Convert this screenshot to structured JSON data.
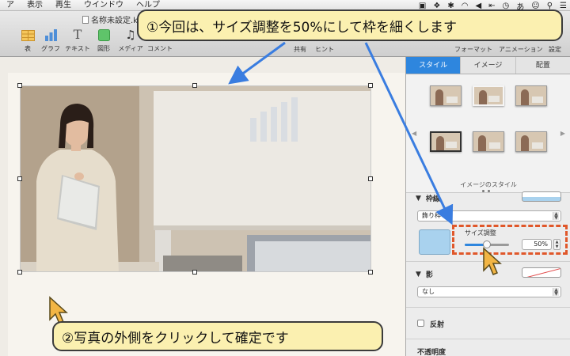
{
  "menubar": {
    "items": [
      "ア",
      "表示",
      "再生",
      "ウインドウ",
      "ヘルプ"
    ],
    "status_icons": [
      "screen-icon",
      "dropbox-icon",
      "bluetooth-icon",
      "wifi-icon",
      "volume-icon",
      "back-icon",
      "clock-icon",
      "input-method-icon",
      "user-icon",
      "search-icon",
      "list-icon"
    ],
    "input_method_label": "あ"
  },
  "toolbar": {
    "doc_title": "名称未設定.k",
    "items": [
      {
        "label": "表",
        "icon": "table-icon"
      },
      {
        "label": "グラフ",
        "icon": "chart-icon"
      },
      {
        "label": "テキスト",
        "icon": "text-icon"
      },
      {
        "label": "図形",
        "icon": "shape-icon"
      },
      {
        "label": "メディア",
        "icon": "media-icon"
      },
      {
        "label": "コメント",
        "icon": "comment-icon"
      }
    ],
    "right_items": [
      "共有",
      "ヒント",
      "フォーマット",
      "アニメーション",
      "設定"
    ]
  },
  "inspector": {
    "tabs": [
      "スタイル",
      "イメージ",
      "配置"
    ],
    "active_tab": "スタイル",
    "image_styles_label": "イメージのスタイル",
    "border": {
      "title": "枠線",
      "type": "飾り枠",
      "size_label": "サイズ調整",
      "size_value": "50%",
      "slider_fraction": 0.5
    },
    "shadow": {
      "title": "影",
      "value": "なし"
    },
    "reflection_label": "反射",
    "opacity_label": "不透明度"
  },
  "callouts": {
    "top": "①今回は、サイズ調整を50%にして枠を細くします",
    "bottom": "②写真の外側をクリックして確定です"
  },
  "colors": {
    "accent": "#2e86de",
    "callout_bg": "#fbf0b0",
    "arrow": "#3a7de0",
    "highlight": "#e0572a",
    "cursor": "#f2b544"
  }
}
